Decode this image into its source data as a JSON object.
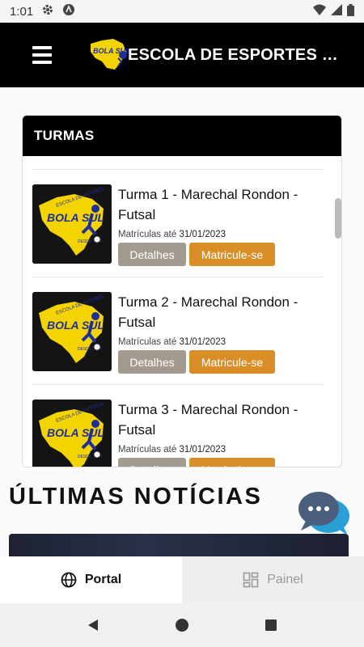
{
  "status_bar": {
    "time": "1:01",
    "icons": [
      "gear-icon",
      "a-circle-icon",
      "wifi-icon",
      "signal-icon",
      "battery-icon"
    ]
  },
  "header": {
    "menu_icon": "hamburger-menu-icon",
    "logo": "bola-sul-logo",
    "logo_text": "BOLA SUL",
    "title": "ESCOLA DE ESPORTES BOLA SUL"
  },
  "turmas": {
    "heading": "TURMAS",
    "items": [
      {
        "title": "Turma 1 - Marechal Rondon - Futsal",
        "date_label": "Matrículas até",
        "date": "31/01/2023",
        "details_label": "Detalhes",
        "enroll_label": "Matricule-se"
      },
      {
        "title": "Turma 2 - Marechal Rondon - Futsal",
        "date_label": "Matrículas até",
        "date": "31/01/2023",
        "details_label": "Detalhes",
        "enroll_label": "Matricule-se"
      },
      {
        "title": "Turma 3 - Marechal Rondon - Futsal",
        "date_label": "Matrículas até",
        "date": "31/01/2023",
        "details_label": "Detalhes",
        "enroll_label": "Matricule-se"
      }
    ],
    "image_text": {
      "school": "ESCOLA DE FUTEBOL",
      "brand": "BOLA SUL",
      "since": "DESDE 1994"
    }
  },
  "news": {
    "heading": "ÚLTIMAS NOTÍCIAS"
  },
  "chat": {
    "icon": "chat-bubbles-icon"
  },
  "tabs": {
    "portal": {
      "label": "Portal",
      "icon": "globe-icon"
    },
    "painel": {
      "label": "Painel",
      "icon": "dashboard-icon"
    }
  },
  "nav": {
    "back": "back-icon",
    "home": "home-icon",
    "recents": "recents-icon"
  },
  "colors": {
    "header_bg": "#000000",
    "details_button": "#a39b8f",
    "enroll_button": "#d98e26",
    "logo_yellow": "#f4d400",
    "logo_blue": "#1f2f9a"
  }
}
